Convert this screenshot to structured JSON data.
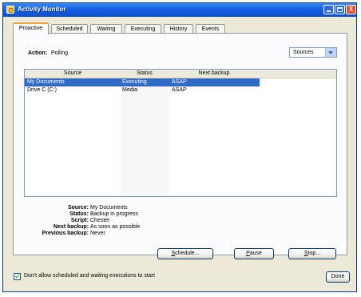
{
  "window": {
    "title": "Activity Monitor",
    "controls": {
      "minimize": "_",
      "maximize": "□",
      "close": "X"
    }
  },
  "tabs": [
    {
      "label": "Proactive",
      "active": true
    },
    {
      "label": "Scheduled",
      "active": false
    },
    {
      "label": "Waiting",
      "active": false
    },
    {
      "label": "Executing",
      "active": false
    },
    {
      "label": "History",
      "active": false
    },
    {
      "label": "Events",
      "active": false
    }
  ],
  "action": {
    "label": "Action:",
    "value": "Polling"
  },
  "sources_select": {
    "selected": "Sources"
  },
  "table": {
    "columns": [
      "Source",
      "Status",
      "Next backup"
    ],
    "rows": [
      {
        "source": "My Documents",
        "status": "Executing",
        "next_backup": "ASAP",
        "selected": true
      },
      {
        "source": "Drive C (C:)",
        "status": "Media",
        "next_backup": "ASAP",
        "selected": false
      }
    ]
  },
  "details": [
    {
      "label": "Source:",
      "value": "My Documents"
    },
    {
      "label": "Status:",
      "value": "Backup in progress"
    },
    {
      "label": "Script:",
      "value": "Chester"
    },
    {
      "label": "Next backup:",
      "value": "As soon as possible"
    },
    {
      "label": "Previous backup:",
      "value": "Never"
    }
  ],
  "buttons": {
    "schedule": {
      "mnemonic": "S",
      "rest": "chedule..."
    },
    "pause": {
      "mnemonic": "P",
      "rest": "ause"
    },
    "stop": {
      "mnemonic": "S",
      "rest": "top..."
    },
    "done": "Done"
  },
  "option": {
    "label": "Don't allow scheduled and waiting executions to start",
    "checked": true
  }
}
